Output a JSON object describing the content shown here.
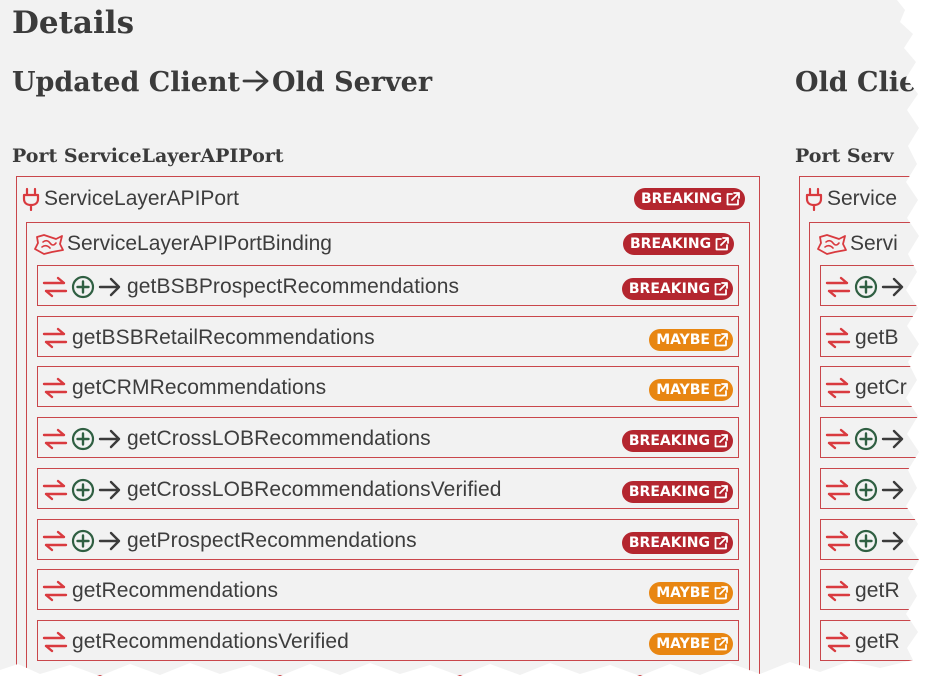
{
  "colors": {
    "breaking": "#b4262f",
    "maybe": "#e88612",
    "border": "#c9464b",
    "swap_icon": "#d93a3f",
    "add_icon": "#2f5f42",
    "text": "#3d3d3d",
    "background": "#f2f2f2"
  },
  "icons": {
    "port": "plug-icon",
    "binding": "binding-icon",
    "operation": "swap-arrows-icon",
    "added": "plus-circle-icon",
    "direction": "arrow-right-icon",
    "external": "external-link-icon"
  },
  "heading": "Details",
  "left": {
    "title_part1": "Updated Client",
    "title_part2": "Old Server",
    "port_heading": "Port ServiceLayerAPIPort",
    "port_name": "ServiceLayerAPIPort",
    "port_badge": "BREAKING",
    "binding_name": "ServiceLayerAPIPortBinding",
    "binding_badge": "BREAKING",
    "operations": [
      {
        "name": "getBSBProspectRecommendations",
        "added": true,
        "badge": "BREAKING"
      },
      {
        "name": "getBSBRetailRecommendations",
        "added": false,
        "badge": "MAYBE"
      },
      {
        "name": "getCRMRecommendations",
        "added": false,
        "badge": "MAYBE"
      },
      {
        "name": "getCrossLOBRecommendations",
        "added": true,
        "badge": "BREAKING"
      },
      {
        "name": "getCrossLOBRecommendationsVerified",
        "added": true,
        "badge": "BREAKING"
      },
      {
        "name": "getProspectRecommendations",
        "added": true,
        "badge": "BREAKING"
      },
      {
        "name": "getRecommendations",
        "added": false,
        "badge": "MAYBE"
      },
      {
        "name": "getRecommendationsVerified",
        "added": false,
        "badge": "MAYBE"
      }
    ]
  },
  "right": {
    "title_visible": "Old Clie",
    "port_heading_visible": "Port Serv",
    "port_name_visible": "Service",
    "binding_name_visible": "Servi",
    "operations_visible": [
      {
        "added": true,
        "text": ""
      },
      {
        "added": false,
        "text": "getB"
      },
      {
        "added": false,
        "text": "getCr"
      },
      {
        "added": true,
        "text": ""
      },
      {
        "added": true,
        "text": ""
      },
      {
        "added": true,
        "text": ""
      },
      {
        "added": false,
        "text": "getR"
      },
      {
        "added": false,
        "text": "getR"
      }
    ]
  }
}
